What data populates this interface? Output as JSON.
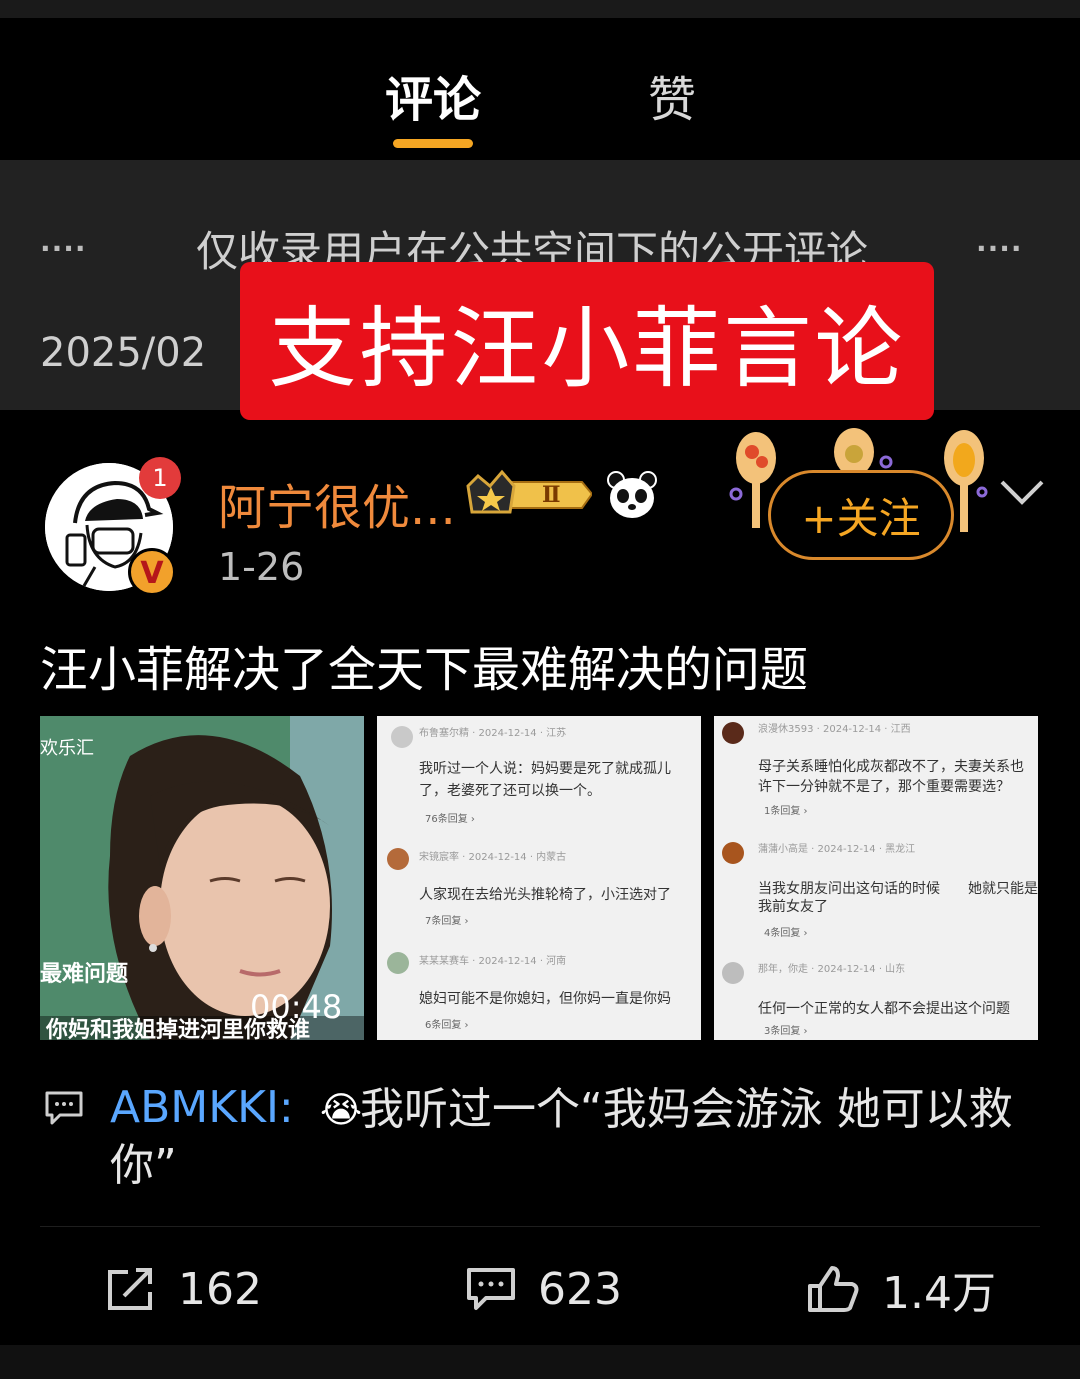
{
  "tabs": [
    {
      "label": "评论"
    },
    {
      "label": "赞"
    }
  ],
  "notice": {
    "text": "仅收录用户在公共空间下的公开评论",
    "dots": "····",
    "date": "2025/02"
  },
  "banner": {
    "text": "支持汪小菲言论"
  },
  "post": {
    "username": "阿宁很优...",
    "date": "1-26",
    "notification_count": "1",
    "verified_badge": "V",
    "level_badge": "Ⅱ",
    "follow_label": "+关注",
    "text": "汪小菲解决了全天下最难解决的问题"
  },
  "media": {
    "video": {
      "duration": "00:48",
      "channel": "欢乐汇",
      "tag": "最难问题",
      "caption": "你妈和我姐掉进河里你救谁"
    },
    "shot1": [
      {
        "meta": "布鲁塞尔精 · 2024-12-14 · 江苏",
        "text": "我听过一个人说：妈妈要是死了就成孤儿",
        "text2": "了，老婆死了还可以换一个。",
        "more": "76条回复 ›"
      },
      {
        "meta": "宋镜宸率 · 2024-12-14 · 内蒙古",
        "text": "人家现在去给光头推轮椅了，小汪选对了",
        "more": "7条回复 ›"
      },
      {
        "meta": "某某某赛车 · 2024-12-14 · 河南",
        "text": "媳妇可能不是你媳妇，但你妈一直是你妈",
        "more": "6条回复 ›"
      }
    ],
    "shot2": [
      {
        "meta": "浪漫休3593 · 2024-12-14 · 江西",
        "text": "母子关系睡怕化成灰都改不了，夫妻关系也",
        "text2": "许下一分钟就不是了，那个重要需要选？",
        "more": "1条回复 ›"
      },
      {
        "meta": "蒲蒲小高是 · 2024-12-14 · 黑龙江",
        "text": "当我女朋友问出这句话的时候　　她就只能是",
        "text2": "我前女友了",
        "more": "4条回复 ›"
      },
      {
        "meta": "那年，你走 · 2024-12-14 · 山东",
        "text": "任何一个正常的女人都不会提出这个问题",
        "more": "3条回复 ›"
      }
    ]
  },
  "reply": {
    "author": "ABMKKI:",
    "emoji": "😭",
    "text": "我听过一个“我妈会游泳 她可以救你”"
  },
  "stats": {
    "share": "162",
    "comments": "623",
    "likes": "1.4万"
  },
  "colors": {
    "accent": "#f5a623",
    "username": "#f08a3c",
    "banner": "#e8101a",
    "link": "#5aa7ff",
    "follow_text": "#f5a623"
  }
}
